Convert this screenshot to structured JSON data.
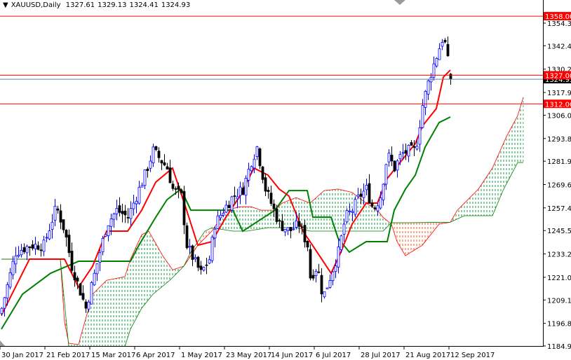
{
  "header": {
    "symbol": "XAUUSD,Daily",
    "open": "1327.61",
    "high": "1329.13",
    "low": "1324.41",
    "close": "1324.93"
  },
  "colors": {
    "bull": "#0000ff",
    "bear": "#000000",
    "tenkan": "#ff0000",
    "kijun": "#008000",
    "cloud_bull": "#1a9e4a",
    "cloud_bear": "#ff5a1a",
    "level": "#ff0000",
    "price_line": "#6a7f9a"
  },
  "levels": [
    {
      "label": "1358.00",
      "price": 1358.0
    },
    {
      "label": "1327.00",
      "price": 1327.0
    },
    {
      "label": "1312.00",
      "price": 1312.0
    }
  ],
  "current_price": {
    "label": "1324.93",
    "price": 1324.93
  },
  "chart_data": {
    "type": "candlestick",
    "title": "XAUUSD,Daily",
    "ylim": [
      1184.95,
      1354.35
    ],
    "y_ticks": [
      "1354.35",
      "1342.45",
      "1330.20",
      "1317.95",
      "1306.05",
      "1293.80",
      "1281.90",
      "1269.65",
      "1257.40",
      "1245.50",
      "1233.25",
      "1221.00",
      "1209.10",
      "1196.85",
      "1184.95"
    ],
    "x_ticks": [
      {
        "bar": 0,
        "label": "30 Jan 2017"
      },
      {
        "bar": 16,
        "label": "21 Feb 2017"
      },
      {
        "bar": 32,
        "label": "15 Mar 2017"
      },
      {
        "bar": 48,
        "label": "6 Apr 2017"
      },
      {
        "bar": 64,
        "label": "1 May 2017"
      },
      {
        "bar": 80,
        "label": "23 May 2017"
      },
      {
        "bar": 96,
        "label": "14 Jun 2017"
      },
      {
        "bar": 112,
        "label": "6 Jul 2017"
      },
      {
        "bar": 128,
        "label": "28 Jul 2017"
      },
      {
        "bar": 144,
        "label": "21 Aug 2017"
      },
      {
        "bar": 160,
        "label": "12 Sep 2017"
      }
    ],
    "close_path": [
      [
        0,
        1204.8
      ],
      [
        5,
        1234.2
      ],
      [
        10,
        1237.8
      ],
      [
        15,
        1237.8
      ],
      [
        19.5,
        1258
      ],
      [
        22.5,
        1245.2
      ],
      [
        25,
        1226.8
      ],
      [
        27.5,
        1215.8
      ],
      [
        30,
        1204.8
      ],
      [
        32.5,
        1219.4
      ],
      [
        35,
        1234.2
      ],
      [
        37.5,
        1248.9
      ],
      [
        41,
        1256.2
      ],
      [
        45,
        1252.5
      ],
      [
        49,
        1267.3
      ],
      [
        51,
        1274.6
      ],
      [
        54,
        1287.4
      ],
      [
        56,
        1283.8
      ],
      [
        59,
        1278.3
      ],
      [
        61,
        1267.3
      ],
      [
        64,
        1263.6
      ],
      [
        66,
        1237.8
      ],
      [
        69,
        1228.6
      ],
      [
        71,
        1223.1
      ],
      [
        74,
        1230.5
      ],
      [
        76,
        1248.9
      ],
      [
        79,
        1256.2
      ],
      [
        82.5,
        1263.6
      ],
      [
        86,
        1267.3
      ],
      [
        89,
        1282
      ],
      [
        91,
        1289.3
      ],
      [
        94,
        1267.3
      ],
      [
        96,
        1259.9
      ],
      [
        99,
        1248.9
      ],
      [
        102.5,
        1245.2
      ],
      [
        106,
        1248.9
      ],
      [
        109,
        1237.8
      ],
      [
        110,
        1221.3
      ],
      [
        112.5,
        1226.8
      ],
      [
        114.5,
        1210.3
      ],
      [
        117.5,
        1223.1
      ],
      [
        120,
        1234.2
      ],
      [
        122.5,
        1252.5
      ],
      [
        125,
        1256.2
      ],
      [
        127.5,
        1263.6
      ],
      [
        130,
        1267.3
      ],
      [
        132.5,
        1256.2
      ],
      [
        135,
        1263.6
      ],
      [
        137.5,
        1285.6
      ],
      [
        140,
        1278.3
      ],
      [
        142.5,
        1285.6
      ],
      [
        145,
        1287.4
      ],
      [
        147.5,
        1287.4
      ],
      [
        150,
        1311.3
      ],
      [
        152.5,
        1326
      ],
      [
        155,
        1337.1
      ],
      [
        157.5,
        1348.1
      ],
      [
        159.5,
        1329.7
      ],
      [
        160,
        1324.93
      ]
    ],
    "tenkan_sen": [
      [
        0,
        1201.1
      ],
      [
        10,
        1230.5
      ],
      [
        17.5,
        1230.5
      ],
      [
        22.5,
        1230.5
      ],
      [
        27.5,
        1215.8
      ],
      [
        32.5,
        1226.8
      ],
      [
        37.5,
        1245.2
      ],
      [
        45,
        1245.2
      ],
      [
        50,
        1256.2
      ],
      [
        55,
        1270.9
      ],
      [
        61,
        1278.3
      ],
      [
        66,
        1256.2
      ],
      [
        70,
        1237.8
      ],
      [
        75,
        1239.7
      ],
      [
        80,
        1252.5
      ],
      [
        85,
        1263.6
      ],
      [
        90,
        1278.3
      ],
      [
        95,
        1274.6
      ],
      [
        99,
        1267.3
      ],
      [
        102.5,
        1263.6
      ],
      [
        107.5,
        1245.2
      ],
      [
        112.5,
        1234.2
      ],
      [
        117.5,
        1223.1
      ],
      [
        121,
        1234.2
      ],
      [
        125,
        1248.9
      ],
      [
        130,
        1259.9
      ],
      [
        134,
        1259.9
      ],
      [
        137.5,
        1272.8
      ],
      [
        142.5,
        1282
      ],
      [
        147.5,
        1291.1
      ],
      [
        150,
        1300.3
      ],
      [
        155,
        1309.5
      ],
      [
        157.5,
        1326
      ],
      [
        160,
        1329.7
      ]
    ],
    "kijun_sen": [
      [
        0,
        1193.8
      ],
      [
        7.5,
        1212.1
      ],
      [
        17.5,
        1223.1
      ],
      [
        27.5,
        1229.4
      ],
      [
        46,
        1229.4
      ],
      [
        49,
        1237.8
      ],
      [
        55,
        1252.5
      ],
      [
        59,
        1261.7
      ],
      [
        64,
        1267.3
      ],
      [
        67.5,
        1256.2
      ],
      [
        82.5,
        1256.2
      ],
      [
        86,
        1245.2
      ],
      [
        97.5,
        1256.2
      ],
      [
        102.5,
        1266.5
      ],
      [
        109,
        1266.5
      ],
      [
        111,
        1252.5
      ],
      [
        117.5,
        1252.5
      ],
      [
        120,
        1241.5
      ],
      [
        124,
        1234.2
      ],
      [
        130,
        1239.7
      ],
      [
        137.5,
        1239.7
      ],
      [
        140,
        1256.2
      ],
      [
        144,
        1267.3
      ],
      [
        147.5,
        1274.6
      ],
      [
        151,
        1289.3
      ],
      [
        156,
        1302.2
      ],
      [
        160,
        1305.1
      ]
    ],
    "senkou_span_a": [
      [
        0,
        1230.5
      ],
      [
        21,
        1230.5
      ],
      [
        22.5,
        1197.4
      ],
      [
        24,
        1186.4
      ],
      [
        27.5,
        1185.7
      ],
      [
        29,
        1193.8
      ],
      [
        32.5,
        1212.1
      ],
      [
        37.5,
        1219.4
      ],
      [
        44,
        1221.3
      ],
      [
        46,
        1230.5
      ],
      [
        50,
        1243.3
      ],
      [
        52.5,
        1245.2
      ],
      [
        57.5,
        1232.3
      ],
      [
        61,
        1224.9
      ],
      [
        65,
        1226.8
      ],
      [
        70,
        1237.8
      ],
      [
        75,
        1245.2
      ],
      [
        80,
        1256.2
      ],
      [
        85,
        1258
      ],
      [
        89,
        1258
      ],
      [
        92.5,
        1256.2
      ],
      [
        97.5,
        1256.2
      ],
      [
        100,
        1259.9
      ],
      [
        105,
        1262.8
      ],
      [
        110,
        1259.9
      ],
      [
        115,
        1266.5
      ],
      [
        120,
        1267.3
      ],
      [
        125,
        1265.5
      ],
      [
        130,
        1259.9
      ],
      [
        134,
        1256.2
      ],
      [
        136,
        1252.5
      ],
      [
        139,
        1248.9
      ],
      [
        141,
        1239.7
      ],
      [
        144,
        1232.3
      ],
      [
        146,
        1234.2
      ],
      [
        150,
        1237.8
      ],
      [
        154,
        1245.2
      ],
      [
        156,
        1248.9
      ],
      [
        160,
        1249.9
      ],
      [
        162.5,
        1256.2
      ],
      [
        165,
        1259.9
      ],
      [
        170,
        1267.3
      ],
      [
        175,
        1278.3
      ],
      [
        180,
        1294.8
      ],
      [
        184,
        1305.8
      ],
      [
        186,
        1315.5
      ]
    ],
    "senkou_span_b": [
      [
        0,
        1230.5
      ],
      [
        21,
        1230.5
      ],
      [
        24,
        1184.6
      ],
      [
        44,
        1184.6
      ],
      [
        46,
        1193.8
      ],
      [
        50,
        1204.8
      ],
      [
        54,
        1212.1
      ],
      [
        60,
        1219.4
      ],
      [
        65,
        1226.8
      ],
      [
        67.5,
        1234.2
      ],
      [
        72.5,
        1245.2
      ],
      [
        75,
        1247
      ],
      [
        82.5,
        1245.2
      ],
      [
        87.5,
        1245.2
      ],
      [
        95,
        1247
      ],
      [
        105,
        1247
      ],
      [
        110,
        1245.2
      ],
      [
        130,
        1245.2
      ],
      [
        136,
        1245.2
      ],
      [
        139,
        1249.6
      ],
      [
        145,
        1249.6
      ],
      [
        160,
        1249.9
      ],
      [
        165,
        1253.3
      ],
      [
        175,
        1253.3
      ],
      [
        179,
        1267.3
      ],
      [
        181,
        1272.8
      ],
      [
        184,
        1281.2
      ],
      [
        186,
        1281.2
      ]
    ]
  }
}
